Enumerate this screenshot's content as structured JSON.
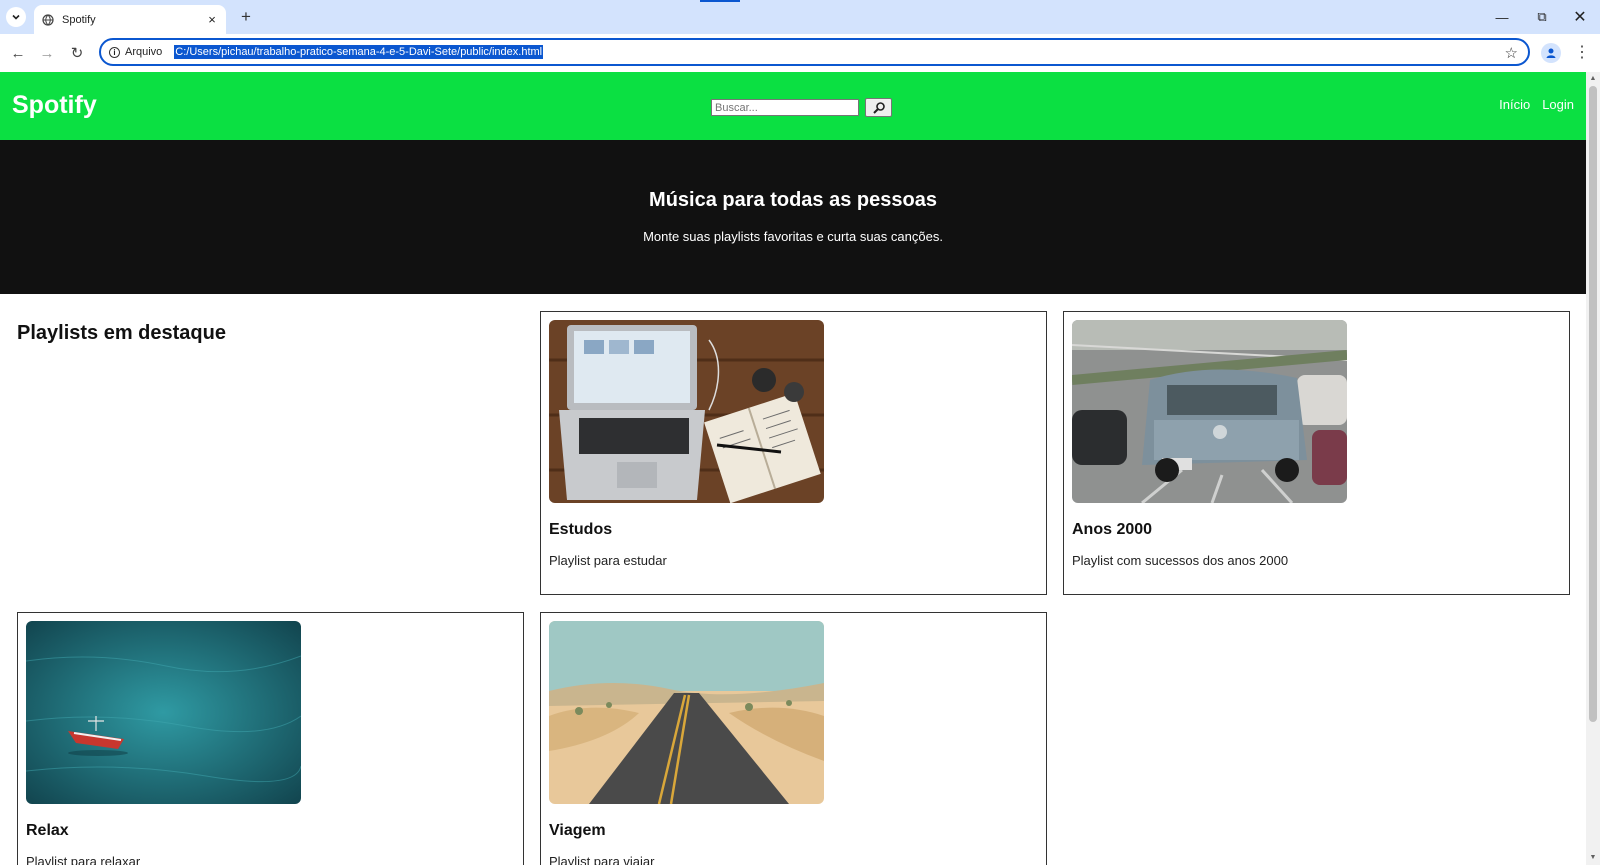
{
  "browser": {
    "tab_title": "Spotify",
    "site_info_label": "Arquivo",
    "url": "C:/Users/pichau/trabalho-pratico-semana-4-e-5-Davi-Sete/public/index.html"
  },
  "header": {
    "logo": "Spotify",
    "search_placeholder": "Buscar...",
    "nav": [
      "Início",
      "Login"
    ]
  },
  "hero": {
    "title": "Música para todas as pessoas",
    "subtitle": "Monte suas playlists favoritas e curta suas canções."
  },
  "playlists": {
    "section_title": "Playlists em destaque",
    "items": [
      {
        "title": "Estudos",
        "description": "Playlist para estudar"
      },
      {
        "title": "Anos 2000",
        "description": "Playlist com sucessos dos anos 2000"
      },
      {
        "title": "Relax",
        "description": "Playlist para relaxar"
      },
      {
        "title": "Viagem",
        "description": "Playlist para viajar"
      }
    ]
  },
  "colors": {
    "header_bg": "#0be042",
    "hero_bg": "#111111",
    "selection": "#0b57d0"
  }
}
